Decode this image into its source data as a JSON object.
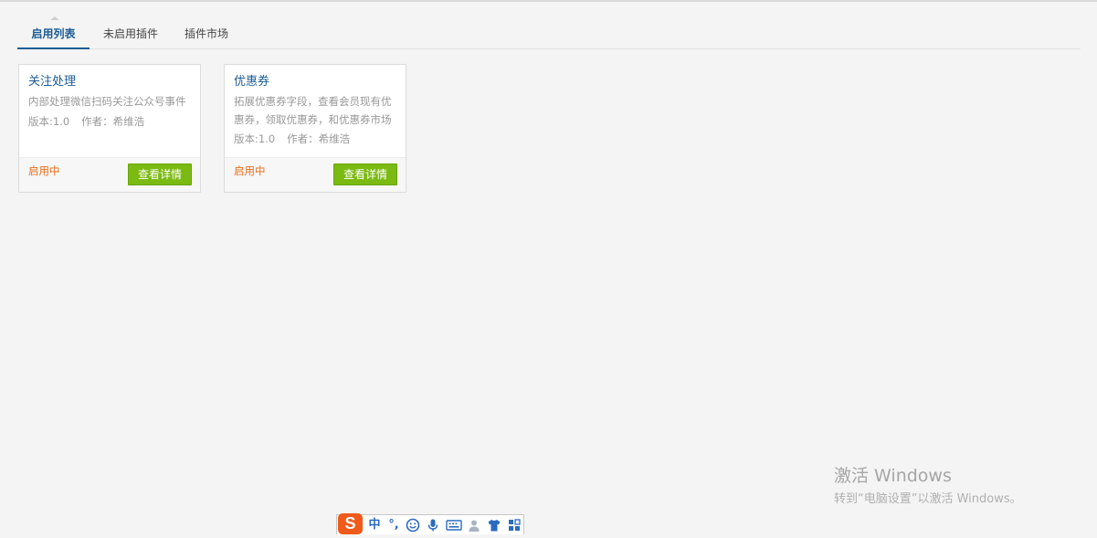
{
  "tabs": [
    {
      "label": "启用列表",
      "active": true
    },
    {
      "label": "未启用插件",
      "active": false
    },
    {
      "label": "插件市场",
      "active": false
    }
  ],
  "plugins": [
    {
      "title": "关注处理",
      "description": "内部处理微信扫码关注公众号事件",
      "version": "版本:1.0",
      "author": "作者：希维浩",
      "status": "启用中",
      "button": "查看详情"
    },
    {
      "title": "优惠券",
      "description": "拓展优惠券字段，查看会员现有优惠券，领取优惠券，和优惠券市场",
      "version": "版本:1.0",
      "author": "作者：希维浩",
      "status": "启用中",
      "button": "查看详情"
    }
  ],
  "watermark": {
    "title": "激活 Windows",
    "subtitle": "转到“电脑设置”以激活 Windows。"
  },
  "ime_toolbar": {
    "logo": "S",
    "mode": "中",
    "punct": "°,",
    "icons": [
      "emoji-icon",
      "microphone-icon",
      "keyboard-icon",
      "user-icon",
      "skin-shirt-icon",
      "toolbox-grid-icon"
    ]
  },
  "colors": {
    "accent": "#1c5c95",
    "status": "#e86f1a",
    "button": "#7bba12",
    "ime_logo": "#f05a1a"
  }
}
